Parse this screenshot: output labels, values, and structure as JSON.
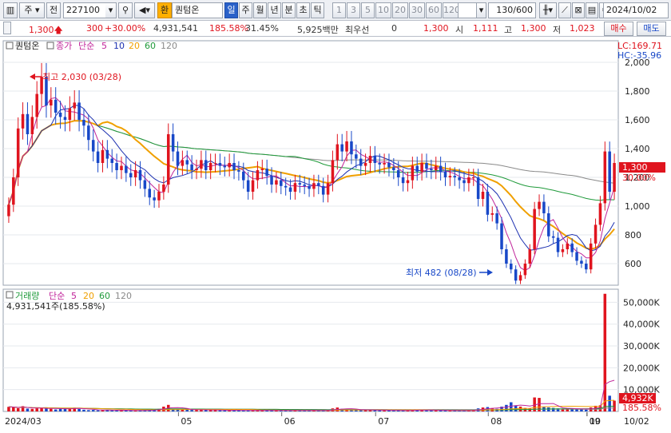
{
  "toolbar": {
    "market": "주",
    "prev_label": "전",
    "code": "227100",
    "fav_badge": "환",
    "stock_name": "퀀텀온",
    "periods": [
      "일",
      "주",
      "월",
      "년",
      "분",
      "초",
      "틱"
    ],
    "selected_period": "일",
    "intervals": [
      "1",
      "3",
      "5",
      "10",
      "20",
      "30",
      "60",
      "120"
    ],
    "count": "130/600",
    "date": "2024/10/02"
  },
  "quote": {
    "price": "1,300",
    "change": "300",
    "change_pct": "+30.00%",
    "volume": "4,931,541",
    "volume_ratio": "185.58%",
    "turnover": "31.45%",
    "amount": "5,925백만",
    "priority_label": "최우선",
    "priority_value": "0",
    "ask_price": "1,300",
    "open_label": "시",
    "open_value": "1,111",
    "high_label": "고",
    "high_value": "1,300",
    "low_label": "저",
    "low_value": "1,023",
    "buy_label": "매수",
    "sell_label": "매도"
  },
  "price_panel": {
    "legend_name": "퀀텀온",
    "legend_items": [
      "종가",
      "단순",
      "5",
      "10",
      "20",
      "60",
      "120"
    ],
    "lc_label": "LC:169.71",
    "hc_label": "HC:-35.96",
    "max_annotation": "최고 2,030 (03/28)",
    "min_annotation": "최저 482 (08/28)",
    "last_price_tag": "1,300",
    "last_pct_tag": "30.00%",
    "y_ticks": [
      "2,000",
      "1,800",
      "1,600",
      "1,400",
      "1,200",
      "1,000",
      "800",
      "600"
    ]
  },
  "volume_panel": {
    "legend_name": "거래량",
    "legend_items": [
      "단순",
      "5",
      "20",
      "60",
      "120"
    ],
    "summary": "4,931,541주(185.58%)",
    "last_volume_tag": "4,932K",
    "last_pct_tag": "185.58%",
    "y_ticks": [
      "50,000K",
      "40,000K",
      "30,000K",
      "20,000K",
      "10,000K"
    ]
  },
  "x_axis": {
    "labels": [
      "2024/03",
      "05",
      "06",
      "07",
      "08",
      "09",
      "10",
      "10/02"
    ]
  },
  "colors": {
    "up": "#e0141e",
    "down": "#1848c8",
    "ma5": "#c0249a",
    "ma10": "#1b2fb0",
    "ma20": "#f0a000",
    "ma60": "#1f9a3a",
    "ma120": "#8a8a8a"
  },
  "chart_data": {
    "type": "candlestick",
    "closes": [
      1010,
      1200,
      1540,
      1640,
      1500,
      1620,
      1780,
      1900,
      1700,
      1740,
      1650,
      1620,
      1600,
      1680,
      1720,
      1600,
      1560,
      1460,
      1380,
      1300,
      1390,
      1330,
      1300,
      1250,
      1280,
      1230,
      1200,
      1250,
      1180,
      1120,
      1060,
      1040,
      1100,
      1150,
      1500,
      1380,
      1280,
      1320,
      1290,
      1250,
      1260,
      1320,
      1250,
      1300,
      1300,
      1280,
      1270,
      1300,
      1250,
      1240,
      1180,
      1100,
      1180,
      1250,
      1260,
      1210,
      1150,
      1180,
      1140,
      1130,
      1100,
      1160,
      1150,
      1140,
      1120,
      1160,
      1140,
      1080,
      1160,
      1320,
      1430,
      1380,
      1450,
      1360,
      1330,
      1280,
      1300,
      1350,
      1300,
      1290,
      1300,
      1270,
      1250,
      1200,
      1160,
      1180,
      1280,
      1240,
      1300,
      1260,
      1250,
      1280,
      1240,
      1200,
      1210,
      1200,
      1180,
      1160,
      1200,
      1200,
      1050,
      1100,
      940,
      950,
      880,
      700,
      600,
      560,
      482,
      520,
      600,
      700,
      980,
      1030,
      950,
      790,
      780,
      680,
      700,
      740,
      680,
      620,
      600,
      560,
      740,
      870,
      1020,
      1380,
      1100,
      1300
    ],
    "volumes_k": [
      2100,
      1900,
      1500,
      2400,
      1300,
      1200,
      1400,
      1500,
      1700,
      1200,
      900,
      1100,
      1300,
      1500,
      1700,
      1100,
      800,
      600,
      700,
      500,
      700,
      600,
      500,
      500,
      600,
      500,
      400,
      400,
      500,
      600,
      700,
      800,
      1200,
      2200,
      3000,
      1200,
      1000,
      900,
      800,
      700,
      700,
      800,
      700,
      600,
      600,
      500,
      500,
      600,
      600,
      500,
      400,
      500,
      600,
      500,
      500,
      500,
      400,
      500,
      500,
      400,
      400,
      600,
      500,
      500,
      400,
      500,
      400,
      400,
      500,
      1400,
      1800,
      1200,
      1000,
      800,
      700,
      600,
      600,
      700,
      600,
      500,
      500,
      500,
      500,
      500,
      400,
      400,
      800,
      600,
      700,
      500,
      500,
      600,
      500,
      400,
      400,
      400,
      400,
      400,
      500,
      500,
      1400,
      1800,
      2000,
      1500,
      1200,
      2200,
      3000,
      4200,
      2800,
      2200,
      1600,
      1400,
      6400,
      6200,
      2200,
      1800,
      1600,
      1400,
      1200,
      1400,
      1200,
      1000,
      1000,
      800,
      1800,
      2600,
      2800,
      53900,
      7200,
      4932
    ],
    "ylim_price": [
      450,
      2150
    ],
    "ylim_volume": [
      0,
      56000
    ]
  }
}
